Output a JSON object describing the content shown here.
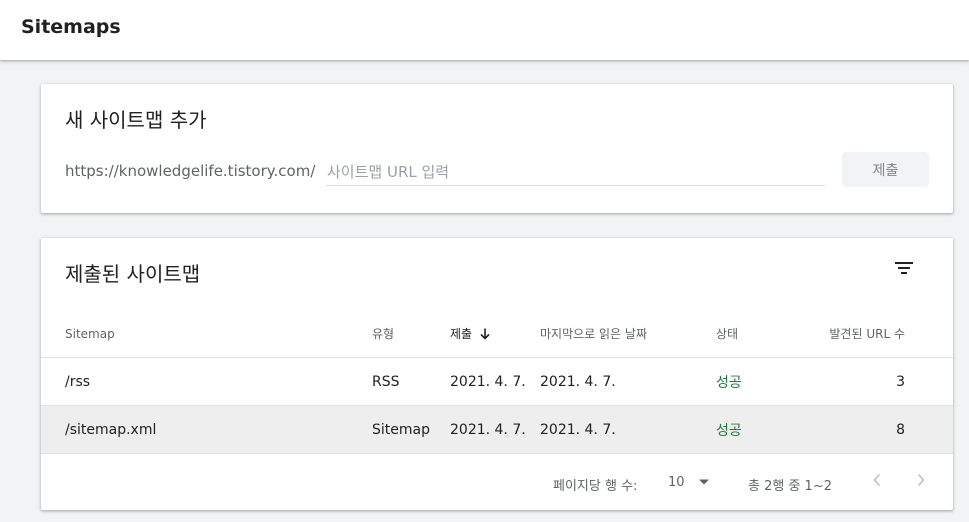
{
  "header": {
    "title": "Sitemaps"
  },
  "add_card": {
    "heading": "새 사이트맵 추가",
    "url_prefix": "https://knowledgelife.tistory.com/",
    "input_value": "",
    "input_placeholder": "사이트맵 URL 입력",
    "submit_label": "제출"
  },
  "list_card": {
    "heading": "제출된 사이트맵",
    "filter_icon": "filter-icon",
    "columns": {
      "sitemap": "Sitemap",
      "type": "유형",
      "submitted": "제출",
      "last_read": "마지막으로 읽은 날짜",
      "status": "상태",
      "discovered": "발견된 URL 수"
    },
    "sort_icon": "arrow-down-icon",
    "rows": [
      {
        "sitemap": "/rss",
        "type": "RSS",
        "submitted": "2021. 4. 7.",
        "last_read": "2021. 4. 7.",
        "status": "성공",
        "discovered": "3"
      },
      {
        "sitemap": "/sitemap.xml",
        "type": "Sitemap",
        "submitted": "2021. 4. 7.",
        "last_read": "2021. 4. 7.",
        "status": "성공",
        "discovered": "8"
      }
    ],
    "pagination": {
      "rows_per_page_label": "페이지당 행 수:",
      "rows_per_page_value": "10",
      "range_text": "총 2행 중 1~2"
    }
  },
  "colors": {
    "success": "#188038",
    "background": "#f1f3f4",
    "card": "#ffffff",
    "selected_row": "#eeeeee"
  }
}
